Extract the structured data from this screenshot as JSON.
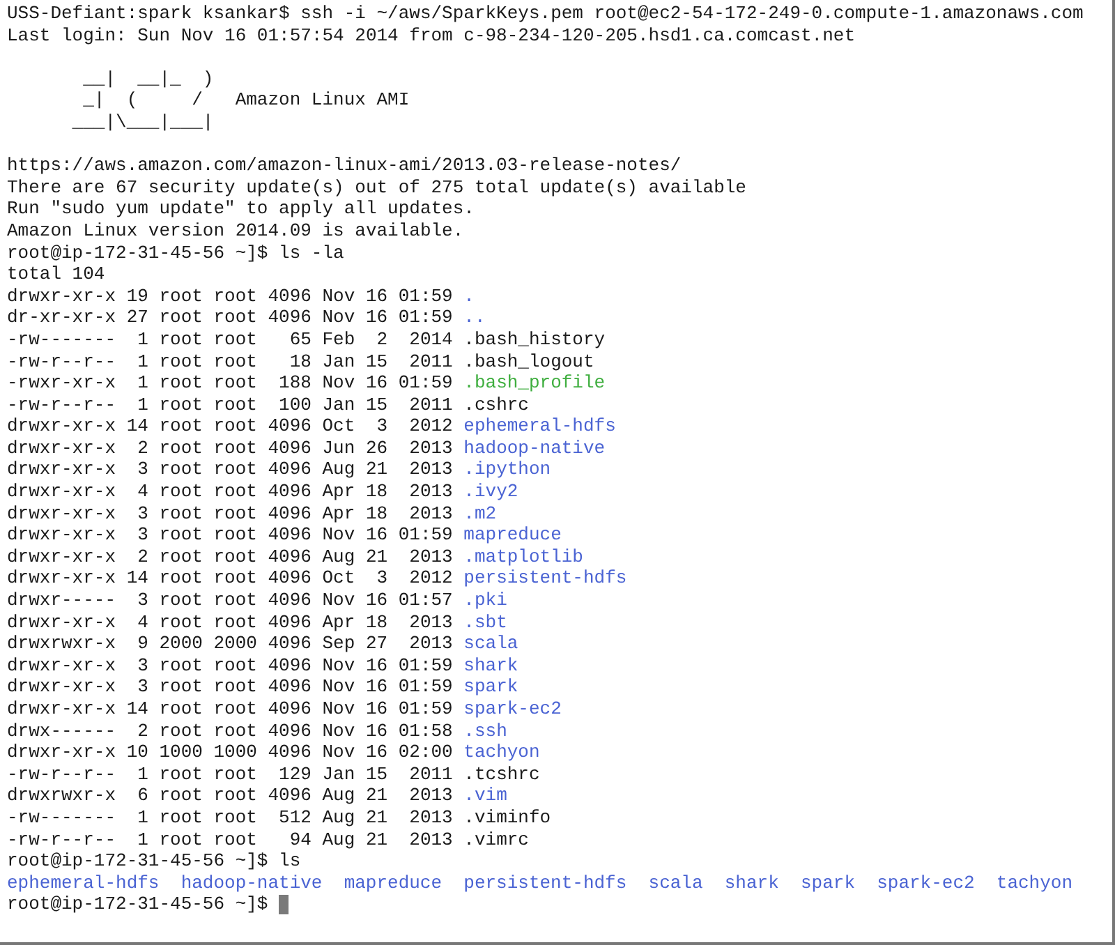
{
  "terminal": {
    "lines": [
      {
        "kind": "text",
        "text": "USS-Defiant:spark ksankar$ ssh -i ~/aws/SparkKeys.pem root@ec2-54-172-249-0.compute-1.amazonaws.com"
      },
      {
        "kind": "text",
        "text": "Last login: Sun Nov 16 01:57:54 2014 from c-98-234-120-205.hsd1.ca.comcast.net"
      },
      {
        "kind": "blank"
      },
      {
        "kind": "art",
        "text": "       __|  __|_  )"
      },
      {
        "kind": "art",
        "text": "       _|  (     /   Amazon Linux AMI"
      },
      {
        "kind": "art",
        "text": "      ___|\\___|___|"
      },
      {
        "kind": "blank"
      },
      {
        "kind": "text",
        "text": "https://aws.amazon.com/amazon-linux-ami/2013.03-release-notes/"
      },
      {
        "kind": "text",
        "text": "There are 67 security update(s) out of 275 total update(s) available"
      },
      {
        "kind": "text",
        "text": "Run \"sudo yum update\" to apply all updates."
      },
      {
        "kind": "text",
        "text": "Amazon Linux version 2014.09 is available."
      },
      {
        "kind": "prompt",
        "text": "root@ip-172-31-45-56 ~]$ ls -la"
      },
      {
        "kind": "text",
        "text": "total 104"
      },
      {
        "kind": "entry",
        "details": "drwxr-xr-x 19 root root 4096 Nov 16 01:59",
        "name": ".",
        "color": "#4a63d3"
      },
      {
        "kind": "entry",
        "details": "dr-xr-xr-x 27 root root 4096 Nov 16 01:59",
        "name": "..",
        "color": "#4a63d3"
      },
      {
        "kind": "entry",
        "details": "-rw-------  1 root root   65 Feb  2  2014",
        "name": ".bash_history",
        "color": "#1a1a1a"
      },
      {
        "kind": "entry",
        "details": "-rw-r--r--  1 root root   18 Jan 15  2011",
        "name": ".bash_logout",
        "color": "#1a1a1a"
      },
      {
        "kind": "entry",
        "details": "-rwxr-xr-x  1 root root  188 Nov 16 01:59",
        "name": ".bash_profile",
        "color": "#3fae3f"
      },
      {
        "kind": "entry",
        "details": "-rw-r--r--  1 root root  100 Jan 15  2011",
        "name": ".cshrc",
        "color": "#1a1a1a"
      },
      {
        "kind": "entry",
        "details": "drwxr-xr-x 14 root root 4096 Oct  3  2012",
        "name": "ephemeral-hdfs",
        "color": "#4a63d3"
      },
      {
        "kind": "entry",
        "details": "drwxr-xr-x  2 root root 4096 Jun 26  2013",
        "name": "hadoop-native",
        "color": "#4a63d3"
      },
      {
        "kind": "entry",
        "details": "drwxr-xr-x  3 root root 4096 Aug 21  2013",
        "name": ".ipython",
        "color": "#4a63d3"
      },
      {
        "kind": "entry",
        "details": "drwxr-xr-x  4 root root 4096 Apr 18  2013",
        "name": ".ivy2",
        "color": "#4a63d3"
      },
      {
        "kind": "entry",
        "details": "drwxr-xr-x  3 root root 4096 Apr 18  2013",
        "name": ".m2",
        "color": "#4a63d3"
      },
      {
        "kind": "entry",
        "details": "drwxr-xr-x  3 root root 4096 Nov 16 01:59",
        "name": "mapreduce",
        "color": "#4a63d3"
      },
      {
        "kind": "entry",
        "details": "drwxr-xr-x  2 root root 4096 Aug 21  2013",
        "name": ".matplotlib",
        "color": "#4a63d3"
      },
      {
        "kind": "entry",
        "details": "drwxr-xr-x 14 root root 4096 Oct  3  2012",
        "name": "persistent-hdfs",
        "color": "#4a63d3"
      },
      {
        "kind": "entry",
        "details": "drwxr-----  3 root root 4096 Nov 16 01:57",
        "name": ".pki",
        "color": "#4a63d3"
      },
      {
        "kind": "entry",
        "details": "drwxr-xr-x  4 root root 4096 Apr 18  2013",
        "name": ".sbt",
        "color": "#4a63d3"
      },
      {
        "kind": "entry",
        "details": "drwxrwxr-x  9 2000 2000 4096 Sep 27  2013",
        "name": "scala",
        "color": "#4a63d3"
      },
      {
        "kind": "entry",
        "details": "drwxr-xr-x  3 root root 4096 Nov 16 01:59",
        "name": "shark",
        "color": "#4a63d3"
      },
      {
        "kind": "entry",
        "details": "drwxr-xr-x  3 root root 4096 Nov 16 01:59",
        "name": "spark",
        "color": "#4a63d3"
      },
      {
        "kind": "entry",
        "details": "drwxr-xr-x 14 root root 4096 Nov 16 01:59",
        "name": "spark-ec2",
        "color": "#4a63d3"
      },
      {
        "kind": "entry",
        "details": "drwx------  2 root root 4096 Nov 16 01:58",
        "name": ".ssh",
        "color": "#4a63d3"
      },
      {
        "kind": "entry",
        "details": "drwxr-xr-x 10 1000 1000 4096 Nov 16 02:00",
        "name": "tachyon",
        "color": "#4a63d3"
      },
      {
        "kind": "entry",
        "details": "-rw-r--r--  1 root root  129 Jan 15  2011",
        "name": ".tcshrc",
        "color": "#1a1a1a"
      },
      {
        "kind": "entry",
        "details": "drwxrwxr-x  6 root root 4096 Aug 21  2013",
        "name": ".vim",
        "color": "#4a63d3"
      },
      {
        "kind": "entry",
        "details": "-rw-------  1 root root  512 Aug 21  2013",
        "name": ".viminfo",
        "color": "#1a1a1a"
      },
      {
        "kind": "entry",
        "details": "-rw-r--r--  1 root root   94 Aug 21  2013",
        "name": ".vimrc",
        "color": "#1a1a1a"
      },
      {
        "kind": "prompt",
        "text": "root@ip-172-31-45-56 ~]$ ls"
      },
      {
        "kind": "names",
        "items": [
          {
            "name": "ephemeral-hdfs",
            "color": "#4a63d3"
          },
          {
            "name": "hadoop-native",
            "color": "#4a63d3"
          },
          {
            "name": "mapreduce",
            "color": "#4a63d3"
          },
          {
            "name": "persistent-hdfs",
            "color": "#4a63d3"
          },
          {
            "name": "scala",
            "color": "#4a63d3"
          },
          {
            "name": "shark",
            "color": "#4a63d3"
          },
          {
            "name": "spark",
            "color": "#4a63d3"
          },
          {
            "name": "spark-ec2",
            "color": "#4a63d3"
          },
          {
            "name": "tachyon",
            "color": "#4a63d3"
          }
        ]
      },
      {
        "kind": "prompt",
        "text": "root@ip-172-31-45-56 ~]$ ",
        "cursor": true
      }
    ]
  }
}
